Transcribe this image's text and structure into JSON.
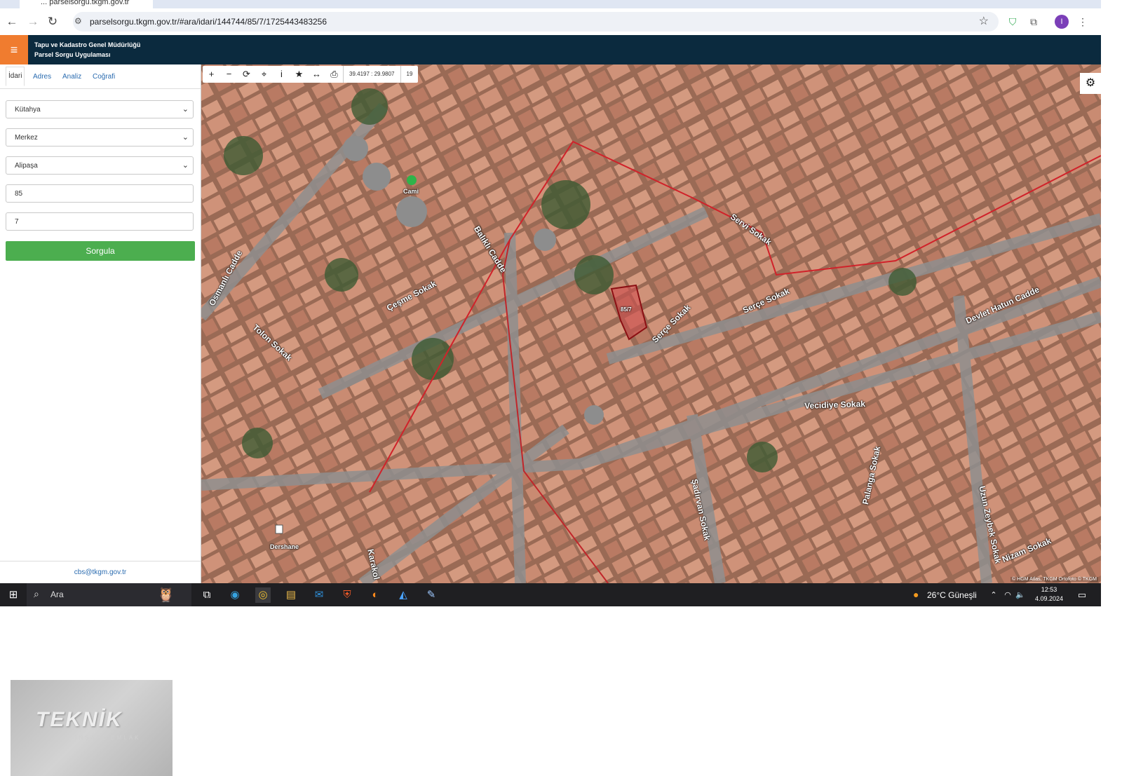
{
  "browser": {
    "tab_title": "... parselsorgu.tkgm.gov.tr",
    "url": "parselsorgu.tkgm.gov.tr/#ara/idari/144744/85/7/1725443483256",
    "profile_initial": "I"
  },
  "app": {
    "title_line1": "Tapu ve Kadastro Genel Müdürlüğü",
    "title_line2": "Parsel Sorgu Uygulaması"
  },
  "left_panel": {
    "tabs": [
      "İdari",
      "Adres",
      "Analiz",
      "Coğrafi"
    ],
    "province": "Kütahya",
    "district": "Merkez",
    "neighborhood": "Alipaşa",
    "block": "85",
    "parcel": "7",
    "query_button": "Sorgula",
    "footer_email": "cbs@tkgm.gov.tr"
  },
  "map": {
    "toolbar": {
      "coordinates": "39.4197 : 29.9807",
      "zoom": "19"
    },
    "parcel_label": "85/7",
    "poi_labels": [
      "Cami",
      "Dershane"
    ],
    "streets": [
      "Balıklı Cadde",
      "Çeşme Sokak",
      "Osmanlı Cadde",
      "Tolon Sokak",
      "Servi Sokak",
      "Serçe Sokak",
      "Devlet Hatun Cadde",
      "Vecidiye Sokak",
      "Palanga Sokak",
      "Şadırvan Sokak",
      "Uzun Zeybek Sokak",
      "Nizam Sokak",
      "Karakol",
      "Serçe Sokak"
    ],
    "attribution": "© HGM Atlas, TKGM Ortofoto © TKGM"
  },
  "taskbar": {
    "search_placeholder": "Ara",
    "weather": "26°C  Güneşli",
    "time": "12:53",
    "date": "4.09.2024"
  },
  "watermark_logo": {
    "brand": "TEKNİK",
    "sub": "İNŞAAT EMLAK"
  }
}
